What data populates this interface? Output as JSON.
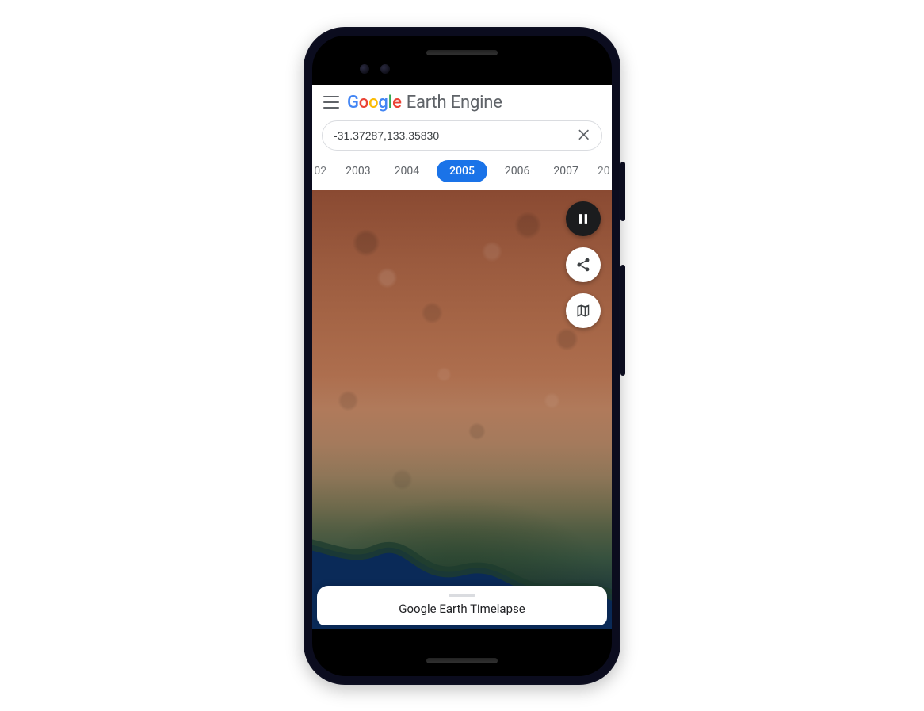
{
  "header": {
    "brand_primary": "Google",
    "brand_secondary": "Earth Engine"
  },
  "search": {
    "value": "-31.37287,133.35830"
  },
  "years": {
    "items": [
      "02",
      "2003",
      "2004",
      "2005",
      "2006",
      "2007",
      "20"
    ],
    "active_index": 3
  },
  "controls": {
    "pause_icon": "pause-icon",
    "share_icon": "share-icon",
    "maps_icon": "maps-icon"
  },
  "bottom_sheet": {
    "title": "Google Earth Timelapse"
  }
}
